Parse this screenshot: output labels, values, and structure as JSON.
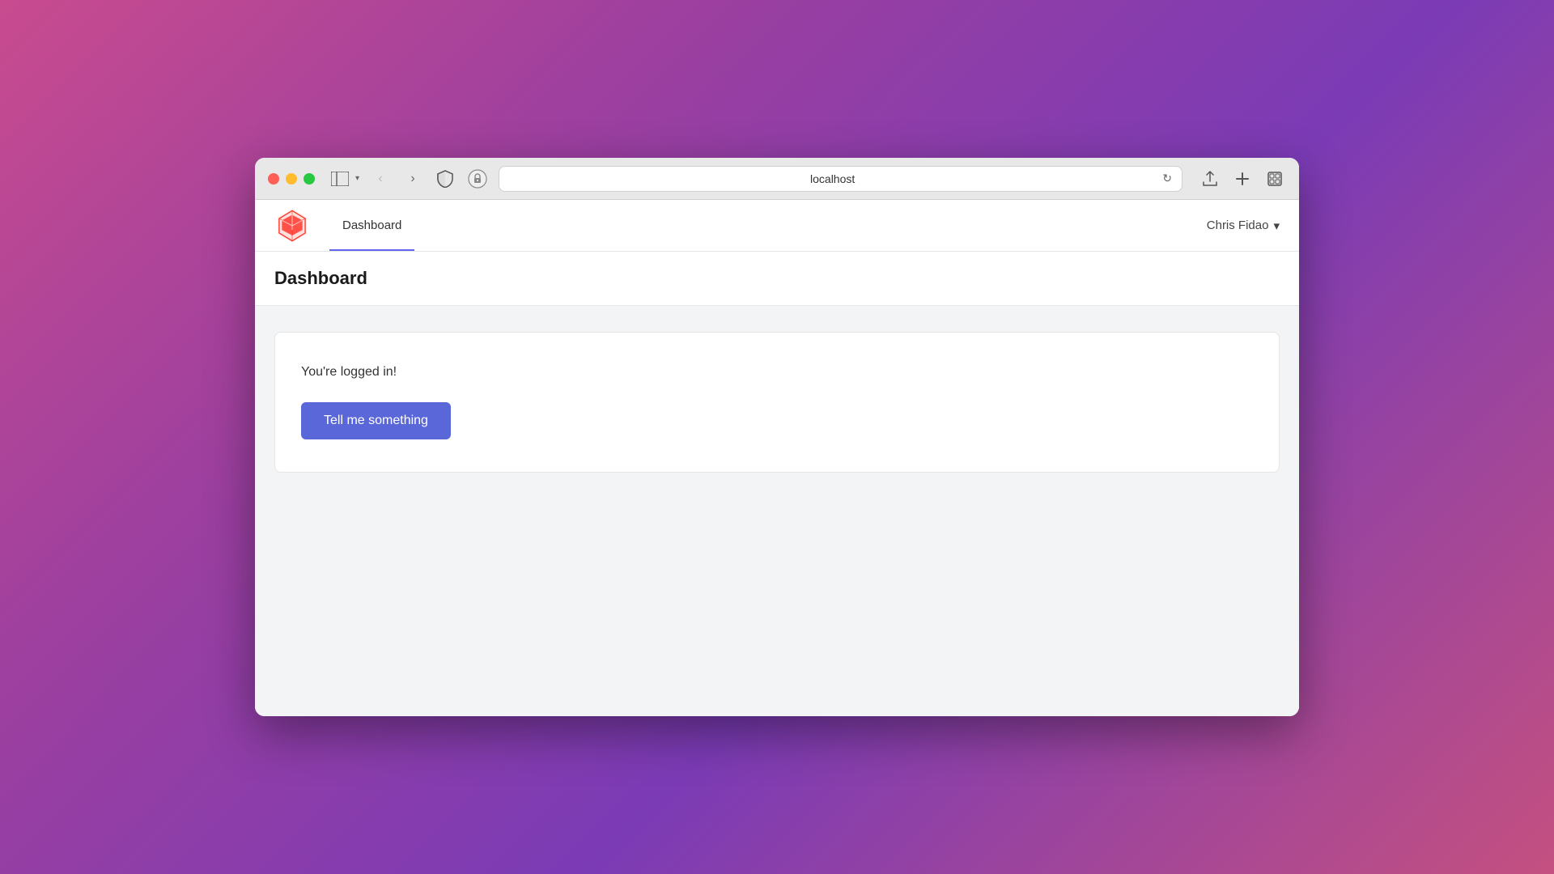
{
  "browser": {
    "address": "localhost",
    "traffic_lights": {
      "red_label": "close",
      "yellow_label": "minimize",
      "green_label": "maximize"
    }
  },
  "nav": {
    "brand_alt": "Laravel Logo",
    "dashboard_link": "Dashboard",
    "user_name": "Chris Fidao",
    "user_chevron": "▾"
  },
  "page": {
    "title": "Dashboard",
    "card": {
      "logged_in_text": "You're logged in!",
      "button_label": "Tell me something"
    }
  }
}
